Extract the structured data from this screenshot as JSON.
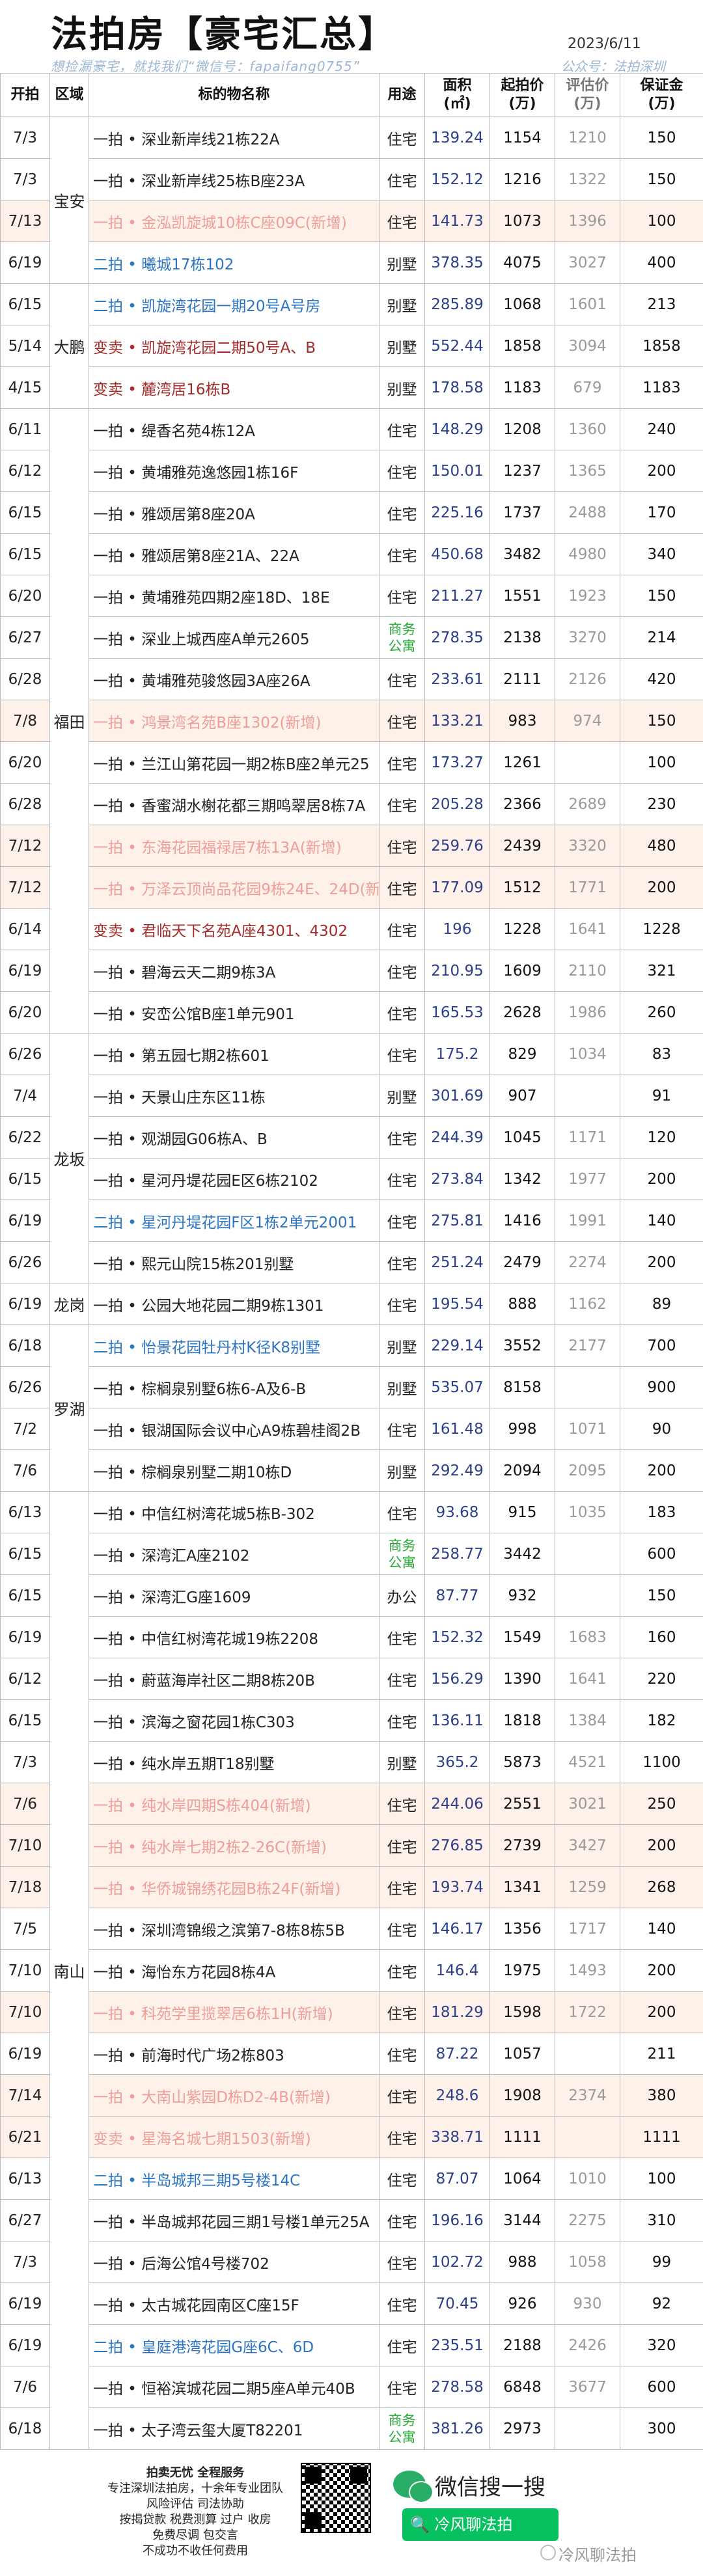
{
  "header": {
    "title": "法拍房【豪宅汇总】",
    "date": "2023/6/11",
    "subtitle": "想捡漏豪宅，就找我们“微信号：fapaifang0755”",
    "account": "公众号：法拍深圳"
  },
  "columns": {
    "date": "开拍",
    "district": "区域",
    "name": "标的物名称",
    "use": "用途",
    "area": "面积\n(㎡)",
    "price": "起拍价\n(万)",
    "eval": "评估价\n(万)",
    "deposit": "保证金\n(万)"
  },
  "rows": [
    {
      "date": "7/3",
      "name": "一拍 • 深业新岸线21栋22A",
      "use": "住宅",
      "area": "139.24",
      "price": "1154",
      "eval": "1210",
      "deposit": "150",
      "style": "normal"
    },
    {
      "date": "7/3",
      "name": "一拍 • 深业新岸线25栋B座23A",
      "use": "住宅",
      "area": "152.12",
      "price": "1216",
      "eval": "1322",
      "deposit": "150",
      "style": "normal"
    },
    {
      "date": "7/13",
      "name": "一拍 • 金泓凯旋城10栋C座09C(新增)",
      "use": "住宅",
      "area": "141.73",
      "price": "1073",
      "eval": "1396",
      "deposit": "100",
      "style": "new"
    },
    {
      "date": "6/19",
      "name": "二拍 • 曦城17栋102",
      "use": "别墅",
      "area": "378.35",
      "price": "4075",
      "eval": "3027",
      "deposit": "400",
      "style": "second"
    },
    {
      "date": "6/15",
      "name": "二拍 • 凯旋湾花园一期20号A号房",
      "use": "别墅",
      "area": "285.89",
      "price": "1068",
      "eval": "1601",
      "deposit": "213",
      "style": "second"
    },
    {
      "date": "5/14",
      "name": "变卖 • 凯旋湾花园二期50号A、B",
      "use": "别墅",
      "area": "552.44",
      "price": "1858",
      "eval": "3094",
      "deposit": "1858",
      "style": "change"
    },
    {
      "date": "4/15",
      "name": "变卖 • 麓湾居16栋B",
      "use": "别墅",
      "area": "178.58",
      "price": "1183",
      "eval": "679",
      "deposit": "1183",
      "style": "change"
    },
    {
      "date": "6/11",
      "name": "一拍 • 缇香名苑4栋12A",
      "use": "住宅",
      "area": "148.29",
      "price": "1208",
      "eval": "1360",
      "deposit": "240",
      "style": "normal"
    },
    {
      "date": "6/12",
      "name": "一拍 • 黄埔雅苑逸悠园1栋16F",
      "use": "住宅",
      "area": "150.01",
      "price": "1237",
      "eval": "1365",
      "deposit": "200",
      "style": "normal"
    },
    {
      "date": "6/15",
      "name": "一拍 • 雅颂居第8座20A",
      "use": "住宅",
      "area": "225.16",
      "price": "1737",
      "eval": "2488",
      "deposit": "170",
      "style": "normal"
    },
    {
      "date": "6/15",
      "name": "一拍 • 雅颂居第8座21A、22A",
      "use": "住宅",
      "area": "450.68",
      "price": "3482",
      "eval": "4980",
      "deposit": "340",
      "style": "normal"
    },
    {
      "date": "6/20",
      "name": "一拍 • 黄埔雅苑四期2座18D、18E",
      "use": "住宅",
      "area": "211.27",
      "price": "1551",
      "eval": "1923",
      "deposit": "150",
      "style": "normal"
    },
    {
      "date": "6/27",
      "name": "一拍 • 深业上城西座A单元2605",
      "use": "商务\n公寓",
      "area": "278.35",
      "price": "2138",
      "eval": "3270",
      "deposit": "214",
      "style": "normal",
      "commercial": true
    },
    {
      "date": "6/28",
      "name": "一拍 • 黄埔雅苑骏悠园3A座26A",
      "use": "住宅",
      "area": "233.61",
      "price": "2111",
      "eval": "2126",
      "deposit": "420",
      "style": "normal"
    },
    {
      "date": "7/8",
      "name": "一拍 • 鸿景湾名苑B座1302(新增)",
      "use": "住宅",
      "area": "133.21",
      "price": "983",
      "eval": "974",
      "deposit": "150",
      "style": "new"
    },
    {
      "date": "6/20",
      "name": "一拍 • 兰江山第花园一期2栋B座2单元25",
      "use": "住宅",
      "area": "173.27",
      "price": "1261",
      "eval": "",
      "deposit": "100",
      "style": "normal"
    },
    {
      "date": "6/28",
      "name": "一拍 • 香蜜湖水榭花都三期鸣翠居8栋7A",
      "use": "住宅",
      "area": "205.28",
      "price": "2366",
      "eval": "2689",
      "deposit": "230",
      "style": "normal"
    },
    {
      "date": "7/12",
      "name": "一拍 • 东海花园福禄居7栋13A(新增)",
      "use": "住宅",
      "area": "259.76",
      "price": "2439",
      "eval": "3320",
      "deposit": "480",
      "style": "new"
    },
    {
      "date": "7/12",
      "name": "一拍 • 万泽云顶尚品花园9栋24E、24D(新",
      "use": "住宅",
      "area": "177.09",
      "price": "1512",
      "eval": "1771",
      "deposit": "200",
      "style": "new"
    },
    {
      "date": "6/14",
      "name": "变卖 • 君临天下名苑A座4301、4302",
      "use": "住宅",
      "area": "196",
      "price": "1228",
      "eval": "1641",
      "deposit": "1228",
      "style": "change"
    },
    {
      "date": "6/19",
      "name": "一拍 • 碧海云天二期9栋3A",
      "use": "住宅",
      "area": "210.95",
      "price": "1609",
      "eval": "2110",
      "deposit": "321",
      "style": "normal"
    },
    {
      "date": "6/20",
      "name": "一拍 • 安峦公馆B座1单元901",
      "use": "住宅",
      "area": "165.53",
      "price": "2628",
      "eval": "1986",
      "deposit": "260",
      "style": "normal"
    },
    {
      "date": "6/26",
      "name": "一拍 • 第五园七期2栋601",
      "use": "住宅",
      "area": "175.2",
      "price": "829",
      "eval": "1034",
      "deposit": "83",
      "style": "normal"
    },
    {
      "date": "7/4",
      "name": "一拍 • 天景山庄东区11栋",
      "use": "别墅",
      "area": "301.69",
      "price": "907",
      "eval": "",
      "deposit": "91",
      "style": "normal"
    },
    {
      "date": "6/22",
      "name": "一拍 • 观湖园G06栋A、B",
      "use": "住宅",
      "area": "244.39",
      "price": "1045",
      "eval": "1171",
      "deposit": "120",
      "style": "normal"
    },
    {
      "date": "6/15",
      "name": "一拍 • 星河丹堤花园E区6栋2102",
      "use": "住宅",
      "area": "273.84",
      "price": "1342",
      "eval": "1977",
      "deposit": "200",
      "style": "normal"
    },
    {
      "date": "6/19",
      "name": "二拍 • 星河丹堤花园F区1栋2单元2001",
      "use": "住宅",
      "area": "275.81",
      "price": "1416",
      "eval": "1991",
      "deposit": "140",
      "style": "second"
    },
    {
      "date": "6/26",
      "name": "一拍 • 熙元山院15栋201别墅",
      "use": "住宅",
      "area": "251.24",
      "price": "2479",
      "eval": "2274",
      "deposit": "200",
      "style": "normal"
    },
    {
      "date": "6/19",
      "name": "一拍 • 公园大地花园二期9栋1301",
      "use": "住宅",
      "area": "195.54",
      "price": "888",
      "eval": "1162",
      "deposit": "89",
      "style": "normal"
    },
    {
      "date": "6/18",
      "name": "二拍 • 怡景花园牡丹村K径K8别墅",
      "use": "别墅",
      "area": "229.14",
      "price": "3552",
      "eval": "2177",
      "deposit": "700",
      "style": "second"
    },
    {
      "date": "6/26",
      "name": "一拍 • 棕榈泉别墅6栋6-A及6-B",
      "use": "别墅",
      "area": "535.07",
      "price": "8158",
      "eval": "",
      "deposit": "900",
      "style": "normal"
    },
    {
      "date": "7/2",
      "name": "一拍 • 银湖国际会议中心A9栋碧桂阁2B",
      "use": "住宅",
      "area": "161.48",
      "price": "998",
      "eval": "1071",
      "deposit": "90",
      "style": "normal"
    },
    {
      "date": "7/6",
      "name": "一拍 • 棕榈泉别墅二期10栋D",
      "use": "别墅",
      "area": "292.49",
      "price": "2094",
      "eval": "2095",
      "deposit": "200",
      "style": "normal"
    },
    {
      "date": "6/13",
      "name": "一拍 • 中信红树湾花城5栋B-302",
      "use": "住宅",
      "area": "93.68",
      "price": "915",
      "eval": "1035",
      "deposit": "183",
      "style": "normal"
    },
    {
      "date": "6/15",
      "name": "一拍 • 深湾汇A座2102",
      "use": "商务\n公寓",
      "area": "258.77",
      "price": "3442",
      "eval": "",
      "deposit": "600",
      "style": "normal",
      "commercial": true
    },
    {
      "date": "6/15",
      "name": "一拍 • 深湾汇G座1609",
      "use": "办公",
      "area": "87.77",
      "price": "932",
      "eval": "",
      "deposit": "150",
      "style": "normal"
    },
    {
      "date": "6/19",
      "name": "一拍 • 中信红树湾花城19栋2208",
      "use": "住宅",
      "area": "152.32",
      "price": "1549",
      "eval": "1683",
      "deposit": "160",
      "style": "normal"
    },
    {
      "date": "6/12",
      "name": "一拍 • 蔚蓝海岸社区二期8栋20B",
      "use": "住宅",
      "area": "156.29",
      "price": "1390",
      "eval": "1641",
      "deposit": "220",
      "style": "normal"
    },
    {
      "date": "6/15",
      "name": "一拍 • 滨海之窗花园1栋C303",
      "use": "住宅",
      "area": "136.11",
      "price": "1818",
      "eval": "1384",
      "deposit": "182",
      "style": "normal"
    },
    {
      "date": "7/3",
      "name": "一拍 • 纯水岸五期T18别墅",
      "use": "别墅",
      "area": "365.2",
      "price": "5873",
      "eval": "4521",
      "deposit": "1100",
      "style": "normal"
    },
    {
      "date": "7/6",
      "name": "一拍 • 纯水岸四期S栋404(新增)",
      "use": "住宅",
      "area": "244.06",
      "price": "2551",
      "eval": "3021",
      "deposit": "250",
      "style": "new"
    },
    {
      "date": "7/10",
      "name": "一拍 • 纯水岸七期2栋2-26C(新增)",
      "use": "住宅",
      "area": "276.85",
      "price": "2739",
      "eval": "3427",
      "deposit": "200",
      "style": "new"
    },
    {
      "date": "7/18",
      "name": "一拍 • 华侨城锦绣花园B栋24F(新增)",
      "use": "住宅",
      "area": "193.74",
      "price": "1341",
      "eval": "1259",
      "deposit": "268",
      "style": "new"
    },
    {
      "date": "7/5",
      "name": "一拍 • 深圳湾锦缎之滨第7-8栋8栋5B",
      "use": "住宅",
      "area": "146.17",
      "price": "1356",
      "eval": "1717",
      "deposit": "140",
      "style": "normal"
    },
    {
      "date": "7/10",
      "name": "一拍 • 海怡东方花园8栋4A",
      "use": "住宅",
      "area": "146.4",
      "price": "1975",
      "eval": "1493",
      "deposit": "200",
      "style": "normal"
    },
    {
      "date": "7/10",
      "name": "一拍 • 科苑学里揽翠居6栋1H(新增)",
      "use": "住宅",
      "area": "181.29",
      "price": "1598",
      "eval": "1722",
      "deposit": "200",
      "style": "new"
    },
    {
      "date": "6/19",
      "name": "一拍 • 前海时代广场2栋803",
      "use": "住宅",
      "area": "87.22",
      "price": "1057",
      "eval": "",
      "deposit": "211",
      "style": "normal"
    },
    {
      "date": "7/14",
      "name": "一拍 • 大南山紫园D栋D2-4B(新增)",
      "use": "住宅",
      "area": "248.6",
      "price": "1908",
      "eval": "2374",
      "deposit": "380",
      "style": "new"
    },
    {
      "date": "6/21",
      "name": "变卖 • 星海名城七期1503(新增)",
      "use": "住宅",
      "area": "338.71",
      "price": "1111",
      "eval": "",
      "deposit": "1111",
      "style": "new"
    },
    {
      "date": "6/13",
      "name": "二拍 • 半岛城邦三期5号楼14C",
      "use": "住宅",
      "area": "87.07",
      "price": "1064",
      "eval": "1010",
      "deposit": "100",
      "style": "second"
    },
    {
      "date": "6/27",
      "name": "一拍 • 半岛城邦花园三期1号楼1单元25A",
      "use": "住宅",
      "area": "196.16",
      "price": "3144",
      "eval": "2275",
      "deposit": "310",
      "style": "normal"
    },
    {
      "date": "7/3",
      "name": "一拍 • 后海公馆4号楼702",
      "use": "住宅",
      "area": "102.72",
      "price": "988",
      "eval": "1058",
      "deposit": "99",
      "style": "normal"
    },
    {
      "date": "6/19",
      "name": "一拍 • 太古城花园南区C座15F",
      "use": "住宅",
      "area": "70.45",
      "price": "926",
      "eval": "930",
      "deposit": "92",
      "style": "normal"
    },
    {
      "date": "6/19",
      "name": "二拍 • 皇庭港湾花园G座6C、6D",
      "use": "住宅",
      "area": "235.51",
      "price": "2188",
      "eval": "2426",
      "deposit": "320",
      "style": "second"
    },
    {
      "date": "7/6",
      "name": "一拍 • 恒裕滨城花园二期5座A单元40B",
      "use": "住宅",
      "area": "278.58",
      "price": "6848",
      "eval": "3677",
      "deposit": "600",
      "style": "normal"
    },
    {
      "date": "6/18",
      "name": "一拍 • 太子湾云玺大厦T82201",
      "use": "商务\n公寓",
      "area": "381.26",
      "price": "2973",
      "eval": "",
      "deposit": "300",
      "style": "normal",
      "commercial": true
    }
  ],
  "districts": [
    {
      "name": "宝安",
      "rows": 4
    },
    {
      "name": "大鹏",
      "rows": 3
    },
    {
      "name": "福田",
      "rows": 15
    },
    {
      "name": "龙坂",
      "rows": 6
    },
    {
      "name": "龙岗",
      "rows": 1
    },
    {
      "name": "罗湖",
      "rows": 4
    },
    {
      "name": "南山",
      "rows": 23
    }
  ],
  "footer": {
    "lines": [
      "拍卖无忧 全程服务",
      "专注深圳法拍房，十余年专业团队",
      "风险评估 司法协助",
      "按揭贷款 税费测算 过户 收房",
      "免费尽调 包交言",
      "不成功不收任何费用"
    ],
    "wechat_search": "微信搜一搜",
    "wechat_button": "冷风聊法拍",
    "watermark": "冷风聊法拍"
  }
}
